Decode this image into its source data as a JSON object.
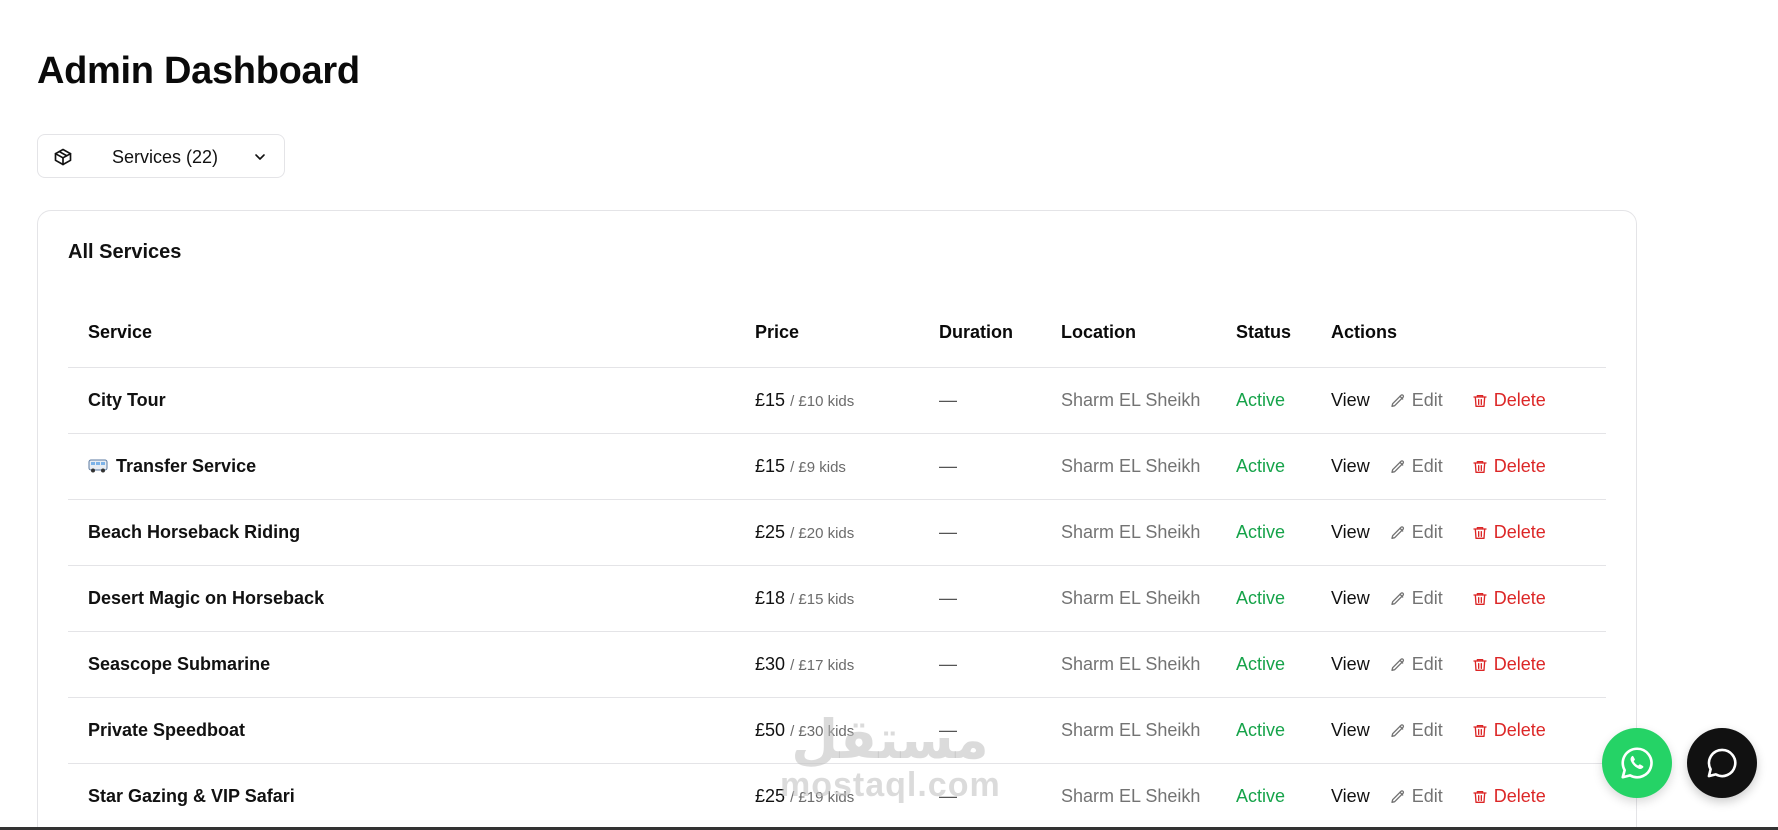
{
  "header": {
    "title": "Admin Dashboard"
  },
  "selector": {
    "label": "Services (22)",
    "icon": "package-icon"
  },
  "card": {
    "title": "All Services"
  },
  "table": {
    "columns": [
      "Service",
      "Price",
      "Duration",
      "Location",
      "Status",
      "Actions"
    ],
    "rows": [
      {
        "name": "City Tour",
        "emoji": "",
        "price": "£15",
        "kids": "/ £10 kids",
        "duration": "—",
        "location": "Sharm EL Sheikh",
        "status": "Active"
      },
      {
        "name": "Transfer Service",
        "emoji": "bus-icon",
        "price": "£15",
        "kids": "/ £9 kids",
        "duration": "—",
        "location": "Sharm EL Sheikh",
        "status": "Active"
      },
      {
        "name": "Beach Horseback Riding",
        "emoji": "",
        "price": "£25",
        "kids": "/ £20 kids",
        "duration": "—",
        "location": "Sharm EL Sheikh",
        "status": "Active"
      },
      {
        "name": "Desert Magic on Horseback",
        "emoji": "",
        "price": "£18",
        "kids": "/ £15 kids",
        "duration": "—",
        "location": "Sharm EL Sheikh",
        "status": "Active"
      },
      {
        "name": "Seascope Submarine",
        "emoji": "",
        "price": "£30",
        "kids": "/ £17 kids",
        "duration": "—",
        "location": "Sharm EL Sheikh",
        "status": "Active"
      },
      {
        "name": "Private Speedboat",
        "emoji": "",
        "price": "£50",
        "kids": "/ £30 kids",
        "duration": "—",
        "location": "Sharm EL Sheikh",
        "status": "Active"
      },
      {
        "name": "Star Gazing & VIP Safari",
        "emoji": "",
        "price": "£25",
        "kids": "/ £19 kids",
        "duration": "—",
        "location": "Sharm EL Sheikh",
        "status": "Active"
      }
    ],
    "actions": {
      "view": "View",
      "edit": "Edit",
      "delete": "Delete"
    }
  },
  "watermark": {
    "arabic": "مستقل",
    "latin": "mostaql.com"
  },
  "colors": {
    "active": "#16a34a",
    "delete": "#dc2626",
    "whatsapp": "#25d366",
    "chat": "#111111"
  }
}
